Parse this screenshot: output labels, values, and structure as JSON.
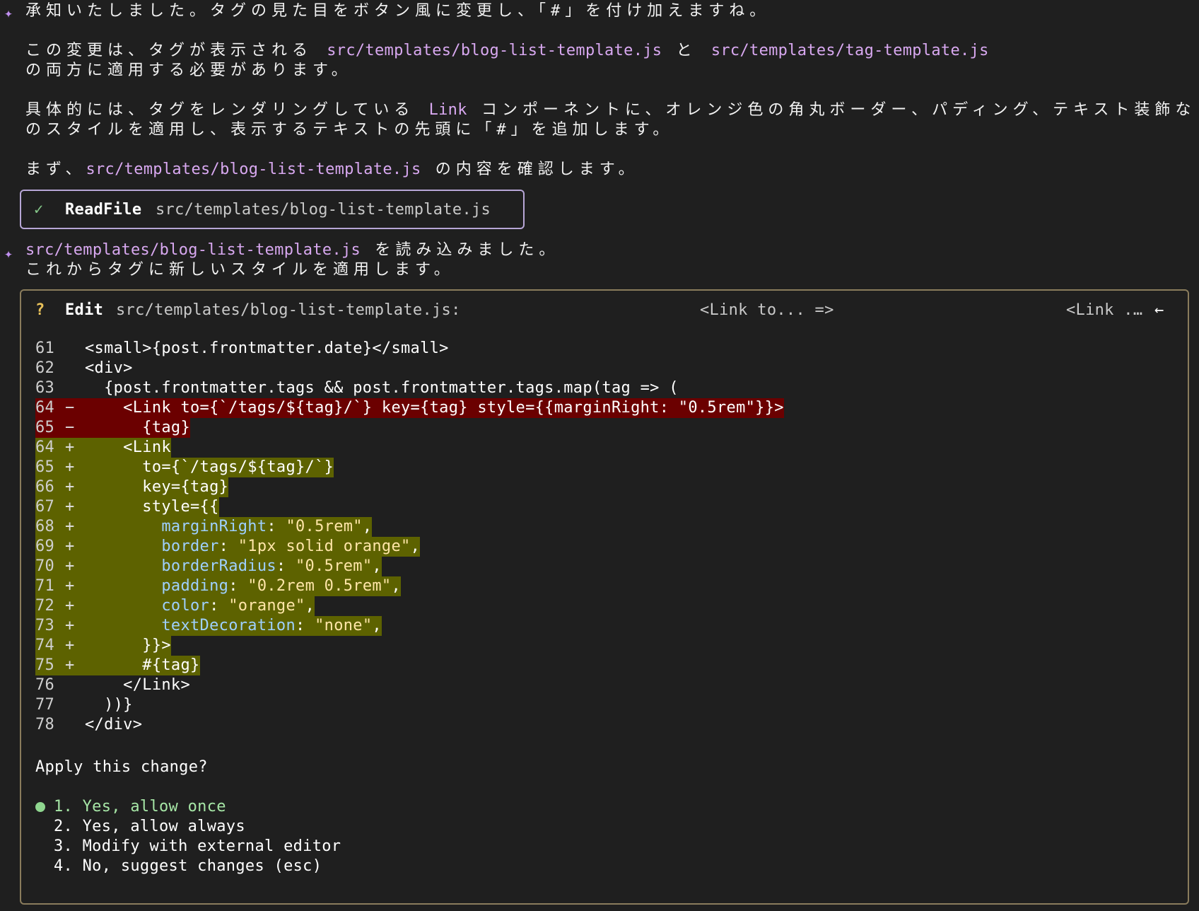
{
  "messages": {
    "m1": "承知いたしました。タグの見た目をボタン風に変更し、「#」を付け加えますね。",
    "m2a_pre": "この変更は、タグが表示される ",
    "m2a_code1": "src/templates/blog-list-template.js",
    "m2a_mid": " と ",
    "m2a_code2": "src/templates/tag-template.js",
    "m2b": "の両方に適用する必要があります。",
    "m3a_pre": "具体的には、タグをレンダリングしている ",
    "m3a_code": "Link",
    "m3a_post": " コンポーネントに、オレンジ色の角丸ボーダー、パディング、テキスト装飾なし",
    "m3b": "のスタイルを適用し、表示するテキストの先頭に「#」を追加します。",
    "m4_pre": "まず、",
    "m4_code": "src/templates/blog-list-template.js",
    "m4_post": " の内容を確認します。",
    "m5a_code": "src/templates/blog-list-template.js",
    "m5a_post": " を読み込みました。",
    "m5b": "これからタグに新しいスタイルを適用します。"
  },
  "tool_call": {
    "status_icon": "✓",
    "name": "ReadFile",
    "path": "src/templates/blog-list-template.js"
  },
  "edit": {
    "marker": "?",
    "name": "Edit",
    "path": "src/templates/blog-list-template.js:",
    "old_snippet": "<Link to... =>",
    "new_snippet": "<Link .…",
    "arrow": "←",
    "lines": [
      {
        "num": "61",
        "sign": "",
        "code": "<small>{post.frontmatter.date}</small>"
      },
      {
        "num": "62",
        "sign": "",
        "code": "<div>"
      },
      {
        "num": "63",
        "sign": "",
        "code": "  {post.frontmatter.tags && post.frontmatter.tags.map(tag => ("
      },
      {
        "num": "64",
        "sign": "-",
        "code": "    <Link to={`/tags/${tag}/`} key={tag} style={{marginRight: \"0.5rem\"}}>"
      },
      {
        "num": "65",
        "sign": "-",
        "code": "      {tag}"
      },
      {
        "num": "64",
        "sign": "+",
        "code": "    <Link"
      },
      {
        "num": "65",
        "sign": "+",
        "code": "      to={`/tags/${tag}/`}"
      },
      {
        "num": "66",
        "sign": "+",
        "code": "      key={tag}"
      },
      {
        "num": "67",
        "sign": "+",
        "code": "      style={{"
      },
      {
        "num": "68",
        "sign": "+",
        "code": "        marginRight: \"0.5rem\","
      },
      {
        "num": "69",
        "sign": "+",
        "code": "        border: \"1px solid orange\","
      },
      {
        "num": "70",
        "sign": "+",
        "code": "        borderRadius: \"0.5rem\","
      },
      {
        "num": "71",
        "sign": "+",
        "code": "        padding: \"0.2rem 0.5rem\","
      },
      {
        "num": "72",
        "sign": "+",
        "code": "        color: \"orange\","
      },
      {
        "num": "73",
        "sign": "+",
        "code": "        textDecoration: \"none\","
      },
      {
        "num": "74",
        "sign": "+",
        "code": "      }}>"
      },
      {
        "num": "75",
        "sign": "+",
        "code": "      #{tag}"
      },
      {
        "num": "76",
        "sign": "",
        "code": "    </Link>"
      },
      {
        "num": "77",
        "sign": "",
        "code": "  ))}"
      },
      {
        "num": "78",
        "sign": "",
        "code": "</div>"
      }
    ],
    "prompt": "Apply this change?",
    "options": [
      "1. Yes, allow once",
      "2. Yes, allow always",
      "3. Modify with external editor",
      "4. No, suggest changes (esc)"
    ],
    "selected_option": 0
  },
  "colors": {
    "background": "#1f1f1f",
    "accent_purple": "#d8a8f0",
    "deleted_bg": "#6b0000",
    "added_bg": "#5d6200",
    "selected_green": "#a6e6a6"
  }
}
